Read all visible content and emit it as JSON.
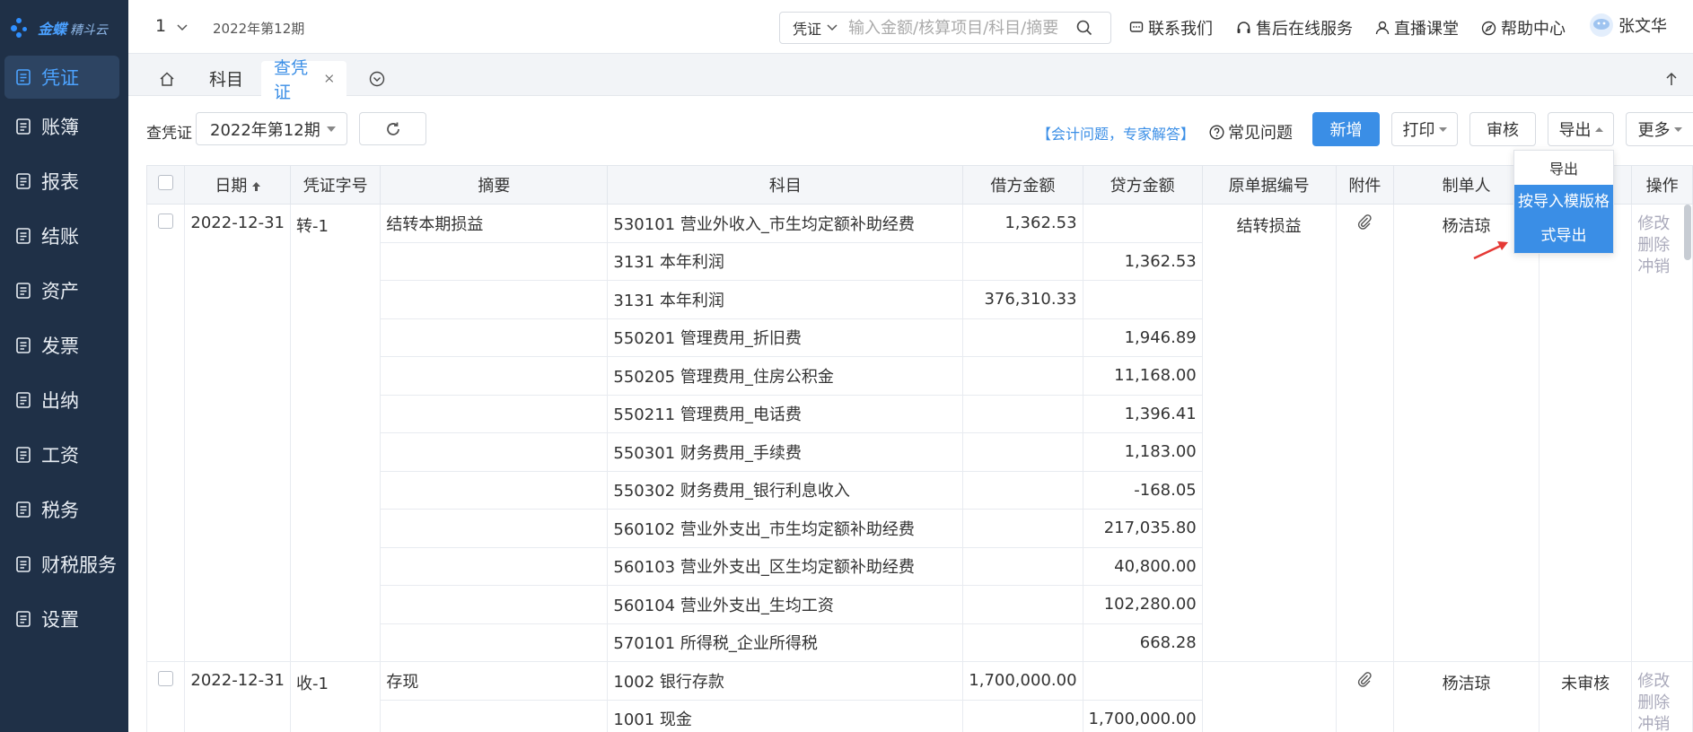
{
  "brand": {
    "name": "金蝶",
    "product": "精斗云"
  },
  "sidebar": {
    "items": [
      {
        "label": "凭证",
        "icon": "voucher-icon",
        "active": true
      },
      {
        "label": "账簿",
        "icon": "ledger-icon"
      },
      {
        "label": "报表",
        "icon": "report-icon"
      },
      {
        "label": "结账",
        "icon": "close-account-icon"
      },
      {
        "label": "资产",
        "icon": "asset-icon"
      },
      {
        "label": "发票",
        "icon": "invoice-icon"
      },
      {
        "label": "出纳",
        "icon": "cashier-icon"
      },
      {
        "label": "工资",
        "icon": "salary-icon"
      },
      {
        "label": "税务",
        "icon": "tax-icon"
      },
      {
        "label": "财税服务",
        "icon": "finance-service-icon"
      },
      {
        "label": "设置",
        "icon": "settings-icon"
      }
    ]
  },
  "topbar": {
    "account": "1",
    "period": "2022年第12期",
    "search_type": "凭证",
    "search_placeholder": "输入金额/核算项目/科目/摘要",
    "links": [
      "联系我们",
      "售后在线服务",
      "直播课堂",
      "帮助中心"
    ],
    "user": "张文华"
  },
  "tabs": [
    {
      "label": "科目"
    },
    {
      "label": "查凭证",
      "active": true
    }
  ],
  "toolbar": {
    "label": "查凭证",
    "period": "2022年第12期",
    "expert_link": "【会计问题，专家解答】",
    "faq": "常见问题",
    "new_btn": "新增",
    "print_btn": "打印",
    "audit_btn": "审核",
    "export_btn": "导出",
    "more_btn": "更多"
  },
  "export_menu": {
    "item1": "导出",
    "item2_line1": "按导入模版格",
    "item2_line2": "式导出"
  },
  "table": {
    "headers": {
      "date": "日期",
      "voucher_no": "凭证字号",
      "summary": "摘要",
      "account": "科目",
      "debit": "借方金额",
      "credit": "贷方金额",
      "source_no": "原单据编号",
      "attachment": "附件",
      "maker": "制单人",
      "status": "",
      "operation": "操作"
    },
    "op_edit": "修改",
    "op_delete": "删除",
    "op_reverse": "冲销",
    "voucher1": {
      "date": "2022-12-31",
      "no": "转-1",
      "summary": "结转本期损益",
      "source": "结转损益",
      "maker": "杨洁琼",
      "lines": [
        {
          "account": "530101 营业外收入_市生均定额补助经费",
          "debit": "1,362.53",
          "credit": ""
        },
        {
          "account": "3131 本年利润",
          "debit": "",
          "credit": "1,362.53"
        },
        {
          "account": "3131 本年利润",
          "debit": "376,310.33",
          "credit": ""
        },
        {
          "account": "550201 管理费用_折旧费",
          "debit": "",
          "credit": "1,946.89"
        },
        {
          "account": "550205 管理费用_住房公积金",
          "debit": "",
          "credit": "11,168.00"
        },
        {
          "account": "550211 管理费用_电话费",
          "debit": "",
          "credit": "1,396.41"
        },
        {
          "account": "550301 财务费用_手续费",
          "debit": "",
          "credit": "1,183.00"
        },
        {
          "account": "550302 财务费用_银行利息收入",
          "debit": "",
          "credit": "-168.05"
        },
        {
          "account": "560102 营业外支出_市生均定额补助经费",
          "debit": "",
          "credit": "217,035.80"
        },
        {
          "account": "560103 营业外支出_区生均定额补助经费",
          "debit": "",
          "credit": "40,800.00"
        },
        {
          "account": "560104 营业外支出_生均工资",
          "debit": "",
          "credit": "102,280.00"
        },
        {
          "account": "570101 所得税_企业所得税",
          "debit": "",
          "credit": "668.28"
        }
      ]
    },
    "voucher2": {
      "date": "2022-12-31",
      "no": "收-1",
      "summary": "存现",
      "source": "",
      "maker": "杨洁琼",
      "status": "未审核",
      "lines": [
        {
          "account": "1002 银行存款",
          "debit": "1,700,000.00",
          "credit": ""
        },
        {
          "account": "1001 现金",
          "debit": "",
          "credit": "1,700,000.00"
        }
      ]
    }
  },
  "colors": {
    "sidebar_bg": "#1f3047",
    "primary": "#3a8ee6",
    "arrow": "#e53935"
  }
}
